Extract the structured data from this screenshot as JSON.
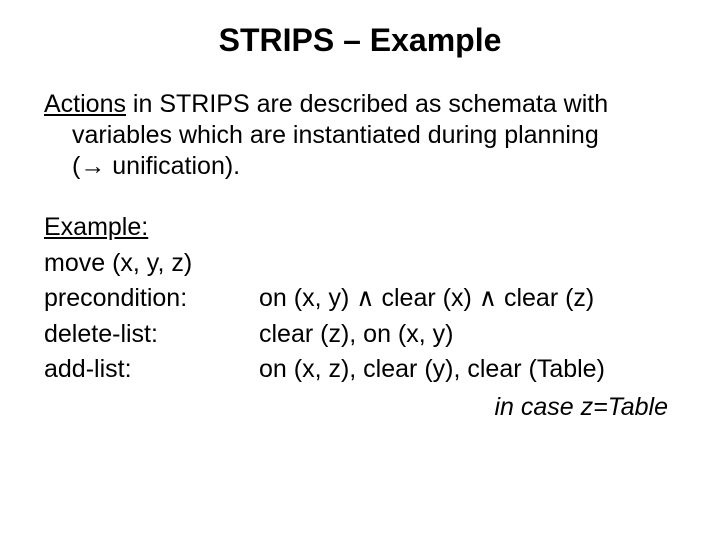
{
  "title": "STRIPS – Example",
  "para": {
    "line1_lead": "Actions",
    "line1_rest": " in STRIPS are described as schemata with",
    "line2": "variables which are instantiated during planning",
    "line3_prefix": "(",
    "arrow": "→",
    "line3_suffix": " unification)."
  },
  "example": {
    "heading": "Example:",
    "move": "move (x, y, z)",
    "rows": {
      "precondition": {
        "label": "precondition:",
        "value": "on (x, y) ∧ clear (x) ∧ clear (z)"
      },
      "delete": {
        "label": "delete-list:",
        "value": "clear (z), on (x, y)"
      },
      "add": {
        "label": "add-list:",
        "value": "on (x, z), clear (y), clear (Table)"
      }
    },
    "note": "in case z=Table"
  }
}
